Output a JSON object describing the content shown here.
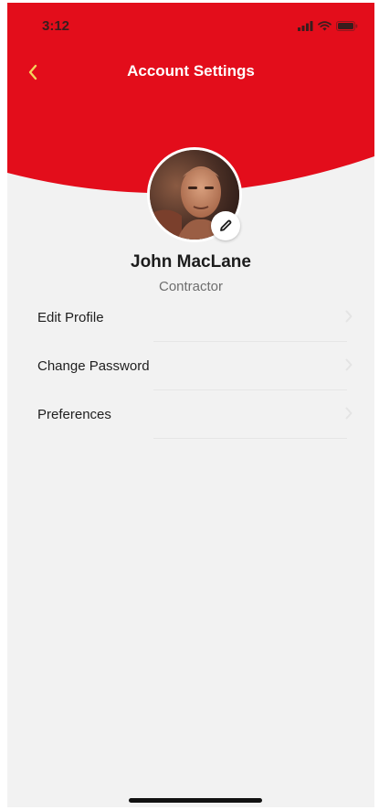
{
  "status_bar": {
    "time": "3:12",
    "icons": [
      "cellular-signal-icon",
      "wifi-icon",
      "battery-icon"
    ]
  },
  "nav": {
    "title": "Account Settings",
    "back_icon": "chevron-left-icon"
  },
  "profile": {
    "name": "John MacLane",
    "role": "Contractor",
    "edit_icon": "pencil-icon"
  },
  "menu": {
    "items": [
      {
        "label": "Edit Profile",
        "icon": "chevron-right-icon"
      },
      {
        "label": "Change Password",
        "icon": "chevron-right-icon"
      },
      {
        "label": "Preferences",
        "icon": "chevron-right-icon"
      }
    ]
  },
  "colors": {
    "header_red": "#e30d1b",
    "back_chevron": "#f4d35e",
    "background": "#f2f2f2",
    "title_text": "#ffffff"
  }
}
